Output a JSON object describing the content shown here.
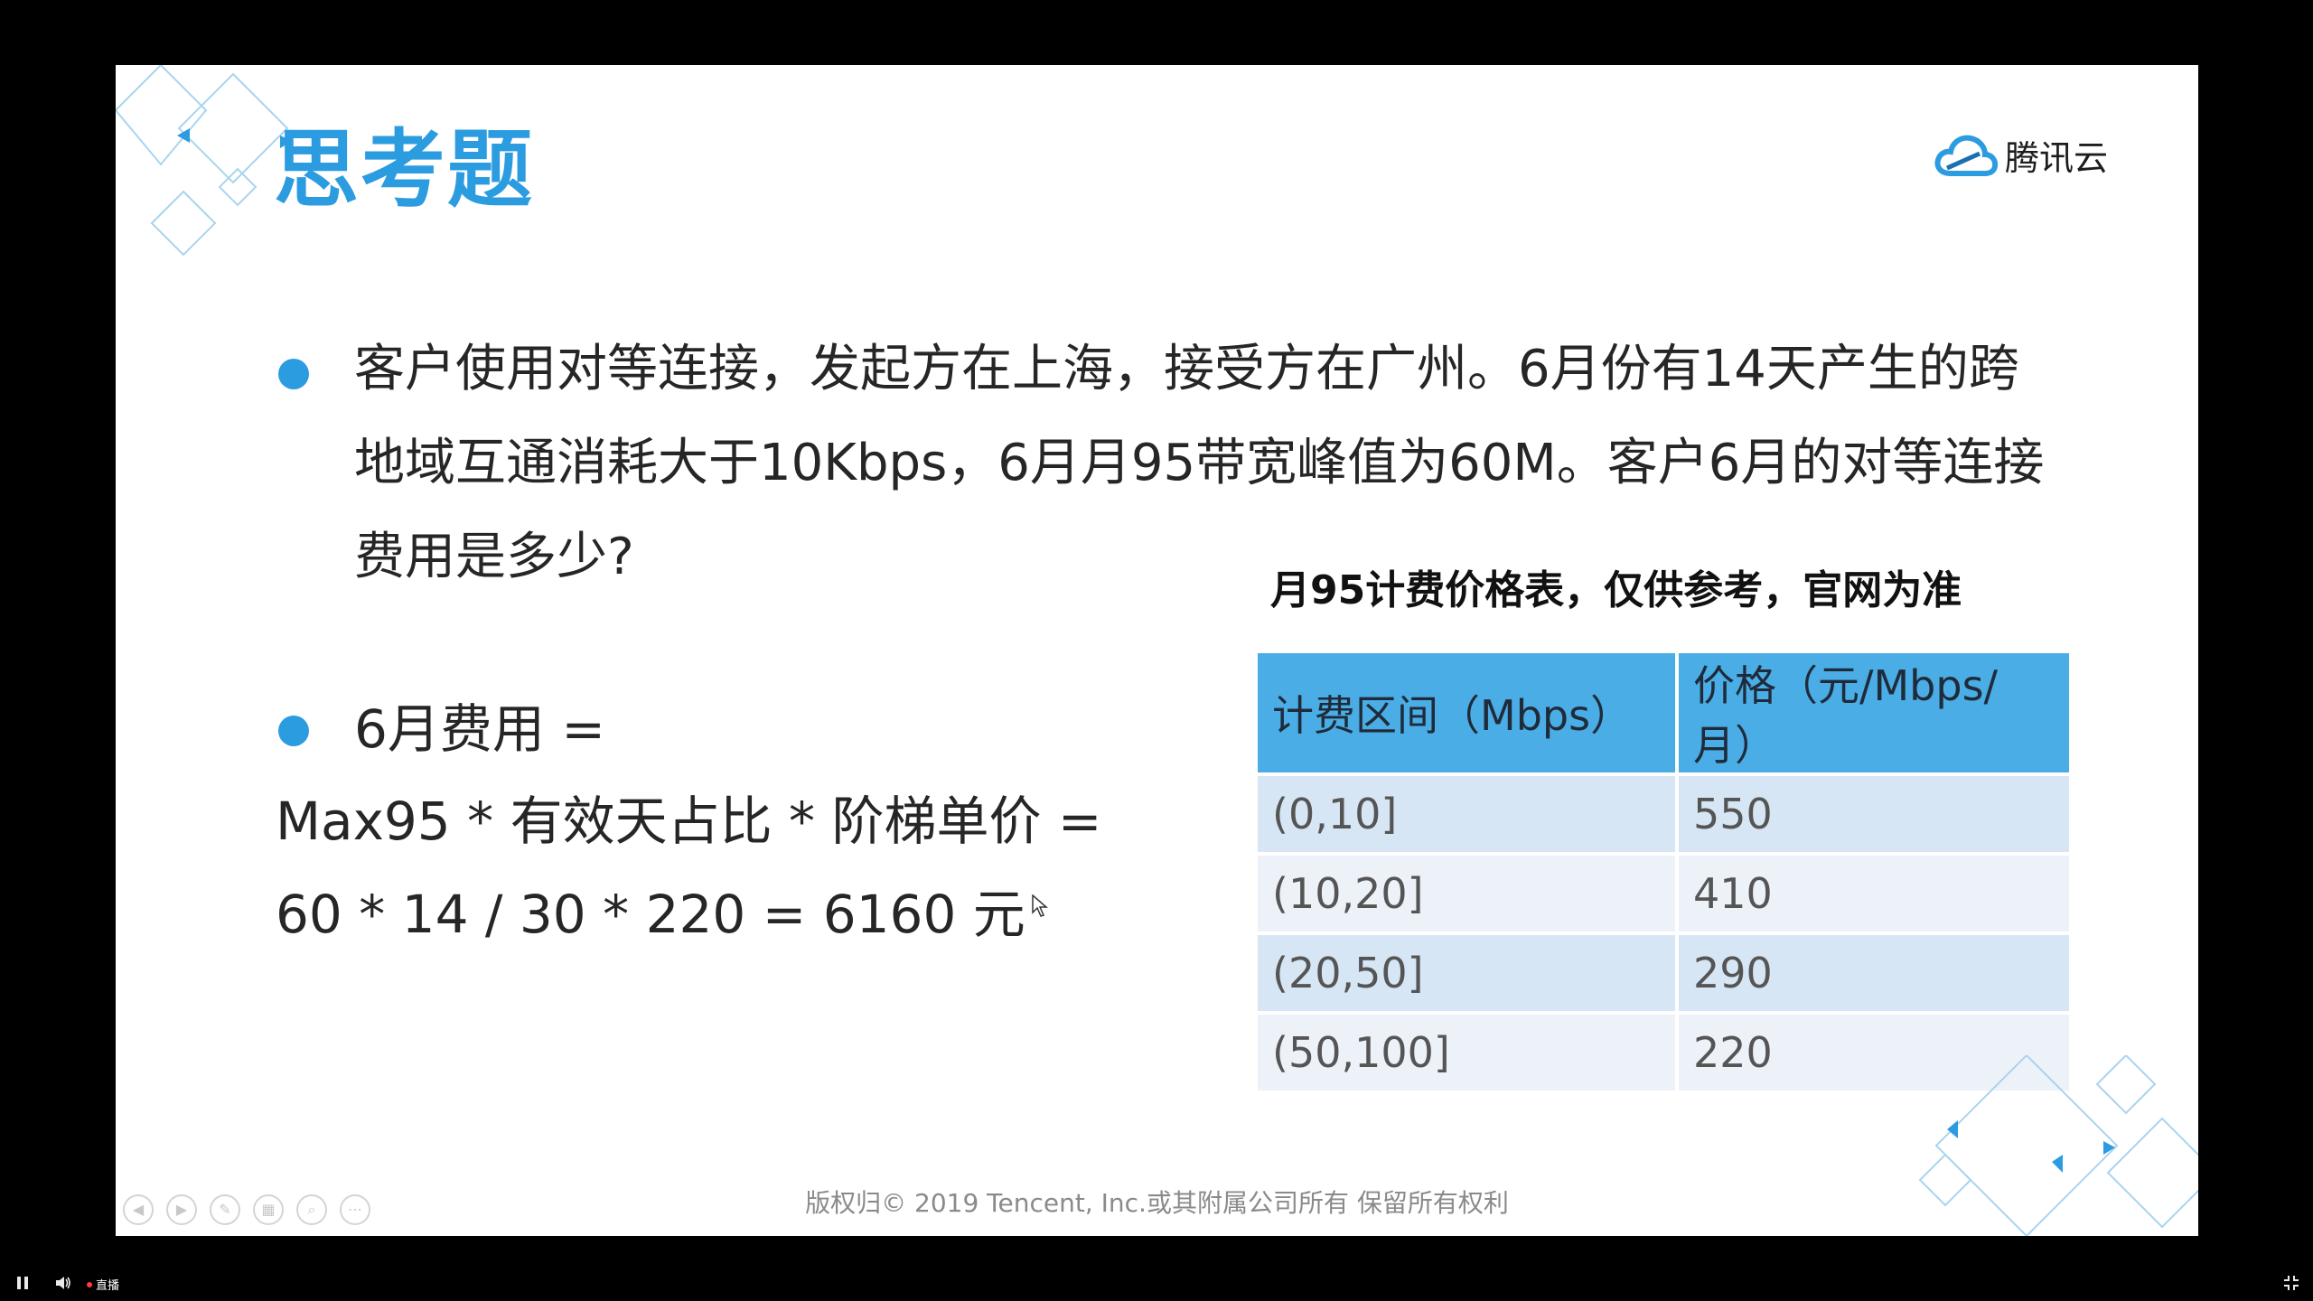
{
  "slide": {
    "title": "思考题",
    "logo_text": "腾讯云",
    "question": "客户使用对等连接，发起方在上海，接受方在广州。6月份有14天产生的跨地域互通消耗大于10Kbps，6月月95带宽峰值为60M。客户6月的对等连接费用是多少?",
    "answer_line1": "6月费用 =",
    "answer_line2": "Max95 * 有效天占比 * 阶梯单价 =",
    "answer_line3": "60 * 14 / 30 * 220 = 6160 元",
    "table_title": "月95计费价格表，仅供参考，官网为准",
    "table": {
      "headers": [
        "计费区间（Mbps）",
        "价格（元/Mbps/月）"
      ],
      "rows": [
        [
          "(0,10]",
          "550"
        ],
        [
          "(10,20]",
          "410"
        ],
        [
          "(20,50]",
          "290"
        ],
        [
          "(50,100]",
          "220"
        ]
      ]
    },
    "copyright": "版权归© 2019 Tencent, Inc.或其附属公司所有 保留所有权利",
    "accent_color": "#2c9ce0",
    "table_header_color": "#4aade5"
  },
  "slide_controls": [
    "prev-icon",
    "next-icon",
    "pen-icon",
    "slides-icon",
    "zoom-icon",
    "more-icon"
  ],
  "player": {
    "live_label": "直播",
    "buttons": [
      "pause-icon",
      "volume-icon",
      "fullscreen-icon"
    ]
  }
}
